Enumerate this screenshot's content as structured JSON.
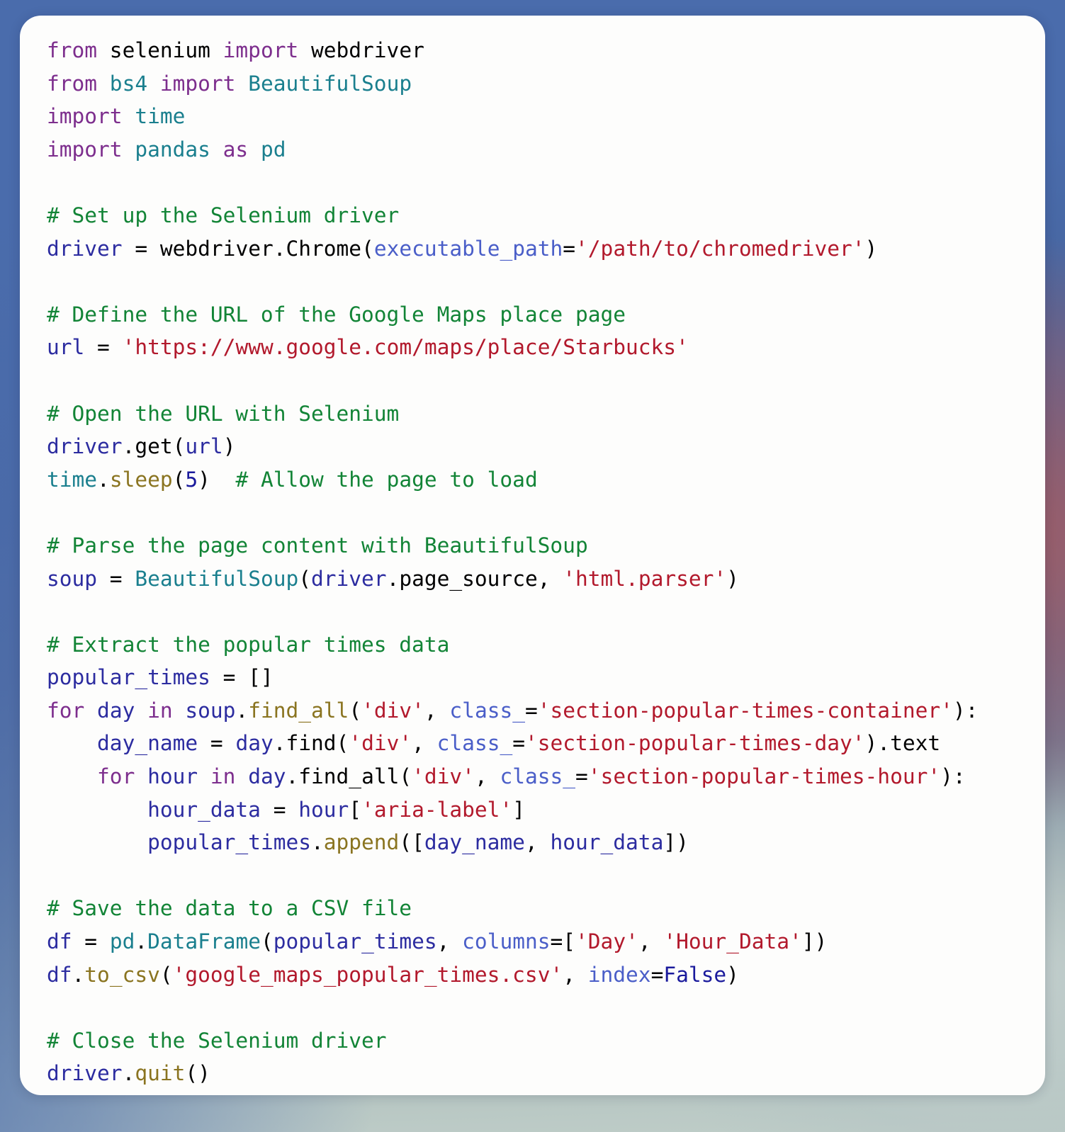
{
  "window": {
    "background_top_color": "#4a6cac",
    "background_bottom_color": "#bfcdc8",
    "card_background": "#fdfdfc",
    "card_corner_radius": "30px"
  },
  "theme": {
    "keyword": "#7d2e8d",
    "constant": "#1a1a9c",
    "name": "#000000",
    "variable": "#2c2ca0",
    "module": "#1a7f8e",
    "function": "#8a7420",
    "string": "#b2192c",
    "comment": "#128436",
    "number": "#1a1a9c",
    "keyword_argument": "#4a5ec8"
  },
  "code": {
    "language": "python",
    "plain_text": "from selenium import webdriver\nfrom bs4 import BeautifulSoup\nimport time\nimport pandas as pd\n\n# Set up the Selenium driver\ndriver = webdriver.Chrome(executable_path='/path/to/chromedriver')\n\n# Define the URL of the Google Maps place page\nurl = 'https://www.google.com/maps/place/Starbucks'\n\n# Open the URL with Selenium\ndriver.get(url)\ntime.sleep(5)  # Allow the page to load\n\n# Parse the page content with BeautifulSoup\nsoup = BeautifulSoup(driver.page_source, 'html.parser')\n\n# Extract the popular times data\npopular_times = []\nfor day in soup.find_all('div', class_='section-popular-times-container'):\n    day_name = day.find('div', class_='section-popular-times-day').text\n    for hour in day.find_all('div', class_='section-popular-times-hour'):\n        hour_data = hour['aria-label']\n        popular_times.append([day_name, hour_data])\n\n# Save the data to a CSV file\ndf = pd.DataFrame(popular_times, columns=['Day', 'Hour_Data'])\ndf.to_csv('google_maps_popular_times.csv', index=False)\n\n# Close the Selenium driver\ndriver.quit()",
    "lines": [
      {
        "n": 1,
        "text": "from selenium import webdriver"
      },
      {
        "n": 2,
        "text": "from bs4 import BeautifulSoup"
      },
      {
        "n": 3,
        "text": "import time"
      },
      {
        "n": 4,
        "text": "import pandas as pd"
      },
      {
        "n": 5,
        "text": ""
      },
      {
        "n": 6,
        "text": "# Set up the Selenium driver"
      },
      {
        "n": 7,
        "text": "driver = webdriver.Chrome(executable_path='/path/to/chromedriver')"
      },
      {
        "n": 8,
        "text": ""
      },
      {
        "n": 9,
        "text": "# Define the URL of the Google Maps place page"
      },
      {
        "n": 10,
        "text": "url = 'https://www.google.com/maps/place/Starbucks'"
      },
      {
        "n": 11,
        "text": ""
      },
      {
        "n": 12,
        "text": "# Open the URL with Selenium"
      },
      {
        "n": 13,
        "text": "driver.get(url)"
      },
      {
        "n": 14,
        "text": "time.sleep(5)  # Allow the page to load"
      },
      {
        "n": 15,
        "text": ""
      },
      {
        "n": 16,
        "text": "# Parse the page content with BeautifulSoup"
      },
      {
        "n": 17,
        "text": "soup = BeautifulSoup(driver.page_source, 'html.parser')"
      },
      {
        "n": 18,
        "text": ""
      },
      {
        "n": 19,
        "text": "# Extract the popular times data"
      },
      {
        "n": 20,
        "text": "popular_times = []"
      },
      {
        "n": 21,
        "text": "for day in soup.find_all('div', class_='section-popular-times-container'):"
      },
      {
        "n": 22,
        "text": "    day_name = day.find('div', class_='section-popular-times-day').text"
      },
      {
        "n": 23,
        "text": "    for hour in day.find_all('div', class_='section-popular-times-hour'):"
      },
      {
        "n": 24,
        "text": "        hour_data = hour['aria-label']"
      },
      {
        "n": 25,
        "text": "        popular_times.append([day_name, hour_data])"
      },
      {
        "n": 26,
        "text": ""
      },
      {
        "n": 27,
        "text": "# Save the data to a CSV file"
      },
      {
        "n": 28,
        "text": "df = pd.DataFrame(popular_times, columns=['Day', 'Hour_Data'])"
      },
      {
        "n": 29,
        "text": "df.to_csv('google_maps_popular_times.csv', index=False)"
      },
      {
        "n": 30,
        "text": ""
      },
      {
        "n": 31,
        "text": "# Close the Selenium driver"
      },
      {
        "n": 32,
        "text": "driver.quit()"
      }
    ],
    "tokens": [
      [
        [
          "kw",
          "from"
        ],
        [
          "nm",
          " selenium "
        ],
        [
          "kw",
          "import"
        ],
        [
          "nm",
          " webdriver"
        ]
      ],
      [
        [
          "kw",
          "from"
        ],
        [
          "mod",
          " bs4 "
        ],
        [
          "kw",
          "import"
        ],
        [
          "cls",
          " BeautifulSoup"
        ]
      ],
      [
        [
          "kw",
          "import"
        ],
        [
          "mod",
          " time"
        ]
      ],
      [
        [
          "kw",
          "import"
        ],
        [
          "mod",
          " pandas "
        ],
        [
          "kw",
          "as"
        ],
        [
          "mod",
          " pd"
        ]
      ],
      [],
      [
        [
          "com",
          "# Set up the Selenium driver"
        ]
      ],
      [
        [
          "var",
          "driver"
        ],
        [
          "op",
          " = "
        ],
        [
          "nm",
          "webdriver"
        ],
        [
          "op",
          "."
        ],
        [
          "nm",
          "Chrome"
        ],
        [
          "op",
          "("
        ],
        [
          "kwarg",
          "executable_path"
        ],
        [
          "op",
          "="
        ],
        [
          "str",
          "'/path/to/chromedriver'"
        ],
        [
          "op",
          ")"
        ]
      ],
      [],
      [
        [
          "com",
          "# Define the URL of the Google Maps place page"
        ]
      ],
      [
        [
          "var",
          "url"
        ],
        [
          "op",
          " = "
        ],
        [
          "str",
          "'https://www.google.com/maps/place/Starbucks'"
        ]
      ],
      [],
      [
        [
          "com",
          "# Open the URL with Selenium"
        ]
      ],
      [
        [
          "var",
          "driver"
        ],
        [
          "op",
          "."
        ],
        [
          "nm",
          "get"
        ],
        [
          "op",
          "("
        ],
        [
          "var",
          "url"
        ],
        [
          "op",
          ")"
        ]
      ],
      [
        [
          "mod",
          "time"
        ],
        [
          "op",
          "."
        ],
        [
          "fn",
          "sleep"
        ],
        [
          "op",
          "("
        ],
        [
          "num",
          "5"
        ],
        [
          "op",
          ")"
        ],
        [
          "nm",
          "  "
        ],
        [
          "com",
          "# Allow the page to load"
        ]
      ],
      [],
      [
        [
          "com",
          "# Parse the page content with BeautifulSoup"
        ]
      ],
      [
        [
          "var",
          "soup"
        ],
        [
          "op",
          " = "
        ],
        [
          "cls",
          "BeautifulSoup"
        ],
        [
          "op",
          "("
        ],
        [
          "var",
          "driver"
        ],
        [
          "op",
          "."
        ],
        [
          "nm",
          "page_source"
        ],
        [
          "op",
          ", "
        ],
        [
          "str",
          "'html.parser'"
        ],
        [
          "op",
          ")"
        ]
      ],
      [],
      [
        [
          "com",
          "# Extract the popular times data"
        ]
      ],
      [
        [
          "var",
          "popular_times"
        ],
        [
          "op",
          " = []"
        ]
      ],
      [
        [
          "kw",
          "for"
        ],
        [
          "var",
          " day "
        ],
        [
          "kw",
          "in"
        ],
        [
          "var",
          " soup"
        ],
        [
          "op",
          "."
        ],
        [
          "fn",
          "find_all"
        ],
        [
          "op",
          "("
        ],
        [
          "str",
          "'div'"
        ],
        [
          "op",
          ", "
        ],
        [
          "kwarg",
          "class_"
        ],
        [
          "op",
          "="
        ],
        [
          "str",
          "'section-popular-times-container'"
        ],
        [
          "op",
          "):"
        ]
      ],
      [
        [
          "nm",
          "    "
        ],
        [
          "var",
          "day_name"
        ],
        [
          "op",
          " = "
        ],
        [
          "var",
          "day"
        ],
        [
          "op",
          "."
        ],
        [
          "nm",
          "find"
        ],
        [
          "op",
          "("
        ],
        [
          "str",
          "'div'"
        ],
        [
          "op",
          ", "
        ],
        [
          "kwarg",
          "class_"
        ],
        [
          "op",
          "="
        ],
        [
          "str",
          "'section-popular-times-day'"
        ],
        [
          "op",
          ")."
        ],
        [
          "nm",
          "text"
        ]
      ],
      [
        [
          "nm",
          "    "
        ],
        [
          "kw",
          "for"
        ],
        [
          "var",
          " hour "
        ],
        [
          "kw",
          "in"
        ],
        [
          "var",
          " day"
        ],
        [
          "op",
          "."
        ],
        [
          "nm",
          "find_all"
        ],
        [
          "op",
          "("
        ],
        [
          "str",
          "'div'"
        ],
        [
          "op",
          ", "
        ],
        [
          "kwarg",
          "class_"
        ],
        [
          "op",
          "="
        ],
        [
          "str",
          "'section-popular-times-hour'"
        ],
        [
          "op",
          "):"
        ]
      ],
      [
        [
          "nm",
          "        "
        ],
        [
          "var",
          "hour_data"
        ],
        [
          "op",
          " = "
        ],
        [
          "var",
          "hour"
        ],
        [
          "op",
          "["
        ],
        [
          "str",
          "'aria-label'"
        ],
        [
          "op",
          "]"
        ]
      ],
      [
        [
          "nm",
          "        "
        ],
        [
          "var",
          "popular_times"
        ],
        [
          "op",
          "."
        ],
        [
          "fn",
          "append"
        ],
        [
          "op",
          "(["
        ],
        [
          "var",
          "day_name"
        ],
        [
          "op",
          ", "
        ],
        [
          "var",
          "hour_data"
        ],
        [
          "op",
          "])"
        ]
      ],
      [],
      [
        [
          "com",
          "# Save the data to a CSV file"
        ]
      ],
      [
        [
          "var",
          "df"
        ],
        [
          "op",
          " = "
        ],
        [
          "mod",
          "pd"
        ],
        [
          "op",
          "."
        ],
        [
          "cls",
          "DataFrame"
        ],
        [
          "op",
          "("
        ],
        [
          "var",
          "popular_times"
        ],
        [
          "op",
          ", "
        ],
        [
          "kwarg",
          "columns"
        ],
        [
          "op",
          "=["
        ],
        [
          "str",
          "'Day'"
        ],
        [
          "op",
          ", "
        ],
        [
          "str",
          "'Hour_Data'"
        ],
        [
          "op",
          "])"
        ]
      ],
      [
        [
          "var",
          "df"
        ],
        [
          "op",
          "."
        ],
        [
          "fn",
          "to_csv"
        ],
        [
          "op",
          "("
        ],
        [
          "str",
          "'google_maps_popular_times.csv'"
        ],
        [
          "op",
          ", "
        ],
        [
          "kwarg",
          "index"
        ],
        [
          "op",
          "="
        ],
        [
          "kwc",
          "False"
        ],
        [
          "op",
          ")"
        ]
      ],
      [],
      [
        [
          "com",
          "# Close the Selenium driver"
        ]
      ],
      [
        [
          "var",
          "driver"
        ],
        [
          "op",
          "."
        ],
        [
          "fn",
          "quit"
        ],
        [
          "op",
          "()"
        ]
      ]
    ]
  }
}
